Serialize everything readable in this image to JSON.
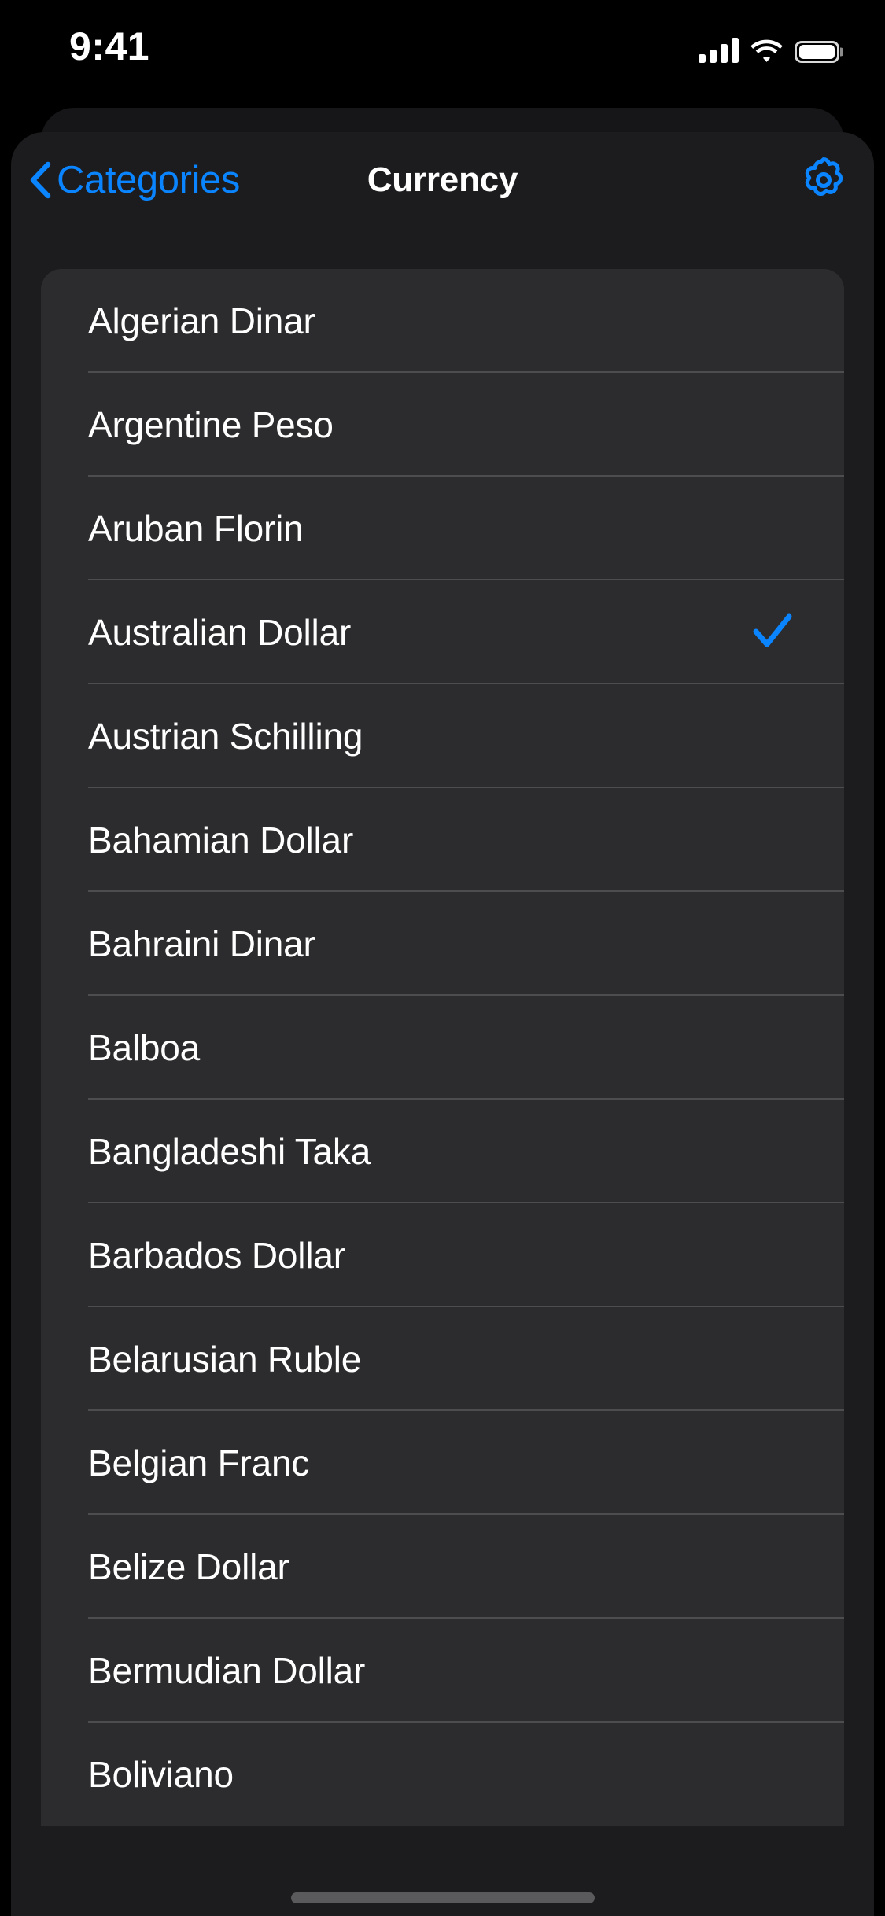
{
  "status_bar": {
    "time": "9:41",
    "cellular_icon": "cellular-bars-icon",
    "wifi_icon": "wifi-icon",
    "battery_icon": "battery-full-icon",
    "signal_bars": 4,
    "battery_level": 100
  },
  "nav": {
    "back_label": "Categories",
    "back_icon": "chevron-left-icon",
    "title": "Currency",
    "settings_icon": "gear-icon"
  },
  "theme": {
    "accent": "#0a84ff",
    "page_background": "#1c1c1e",
    "card_background": "#2c2c2e",
    "separator": "rgba(255,255,255,0.16)",
    "text_primary": "#ffffff"
  },
  "list": {
    "selected": "Australian Dollar",
    "checkmark_icon": "checkmark-icon",
    "items": [
      {
        "label": "Algerian Dinar",
        "selected": false
      },
      {
        "label": "Argentine Peso",
        "selected": false
      },
      {
        "label": "Aruban Florin",
        "selected": false
      },
      {
        "label": "Australian Dollar",
        "selected": true
      },
      {
        "label": "Austrian Schilling",
        "selected": false
      },
      {
        "label": "Bahamian Dollar",
        "selected": false
      },
      {
        "label": "Bahraini Dinar",
        "selected": false
      },
      {
        "label": "Balboa",
        "selected": false
      },
      {
        "label": "Bangladeshi Taka",
        "selected": false
      },
      {
        "label": "Barbados Dollar",
        "selected": false
      },
      {
        "label": "Belarusian Ruble",
        "selected": false
      },
      {
        "label": "Belgian Franc",
        "selected": false
      },
      {
        "label": "Belize Dollar",
        "selected": false
      },
      {
        "label": "Bermudian Dollar",
        "selected": false
      },
      {
        "label": "Boliviano",
        "selected": false
      }
    ]
  },
  "home_indicator": {
    "name": "home-indicator"
  }
}
